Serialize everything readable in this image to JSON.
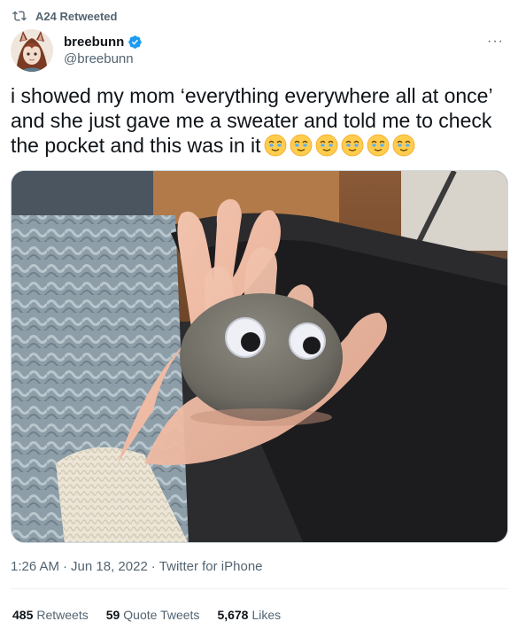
{
  "retweet": {
    "label": "A24 Retweeted"
  },
  "author": {
    "display_name": "breebunn",
    "handle": "@breebunn",
    "verified": true
  },
  "tweet": {
    "text_line1": "i showed my mom ‘everything everywhere all at once’",
    "text_line2": "and she just gave me a sweater and told me to check",
    "text_line3": "the pocket and this was in it",
    "emoji_count": 6,
    "emoji_name": "smiling-face-with-tear-eyes"
  },
  "photo": {
    "description_icon": "image"
  },
  "meta": {
    "time": "1:26 AM",
    "separator": "·",
    "date": "Jun 18, 2022",
    "source": "Twitter for iPhone"
  },
  "stats": [
    {
      "count": "485",
      "label": "Retweets"
    },
    {
      "count": "59",
      "label": "Quote Tweets"
    },
    {
      "count": "5,678",
      "label": "Likes"
    }
  ],
  "colors": {
    "text": "#0f1419",
    "secondary": "#536471",
    "verified": "#1d9bf0",
    "divider": "#eff3f4"
  }
}
